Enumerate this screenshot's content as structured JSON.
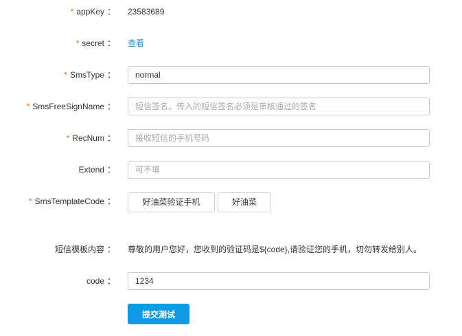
{
  "form": {
    "appkey": {
      "label": "appKey",
      "value": "23583689",
      "required": true
    },
    "secret": {
      "label": "secret",
      "link_text": "查看",
      "required": true
    },
    "smstype": {
      "label": "SmsType",
      "value": "normal",
      "placeholder": "",
      "required": true
    },
    "signname": {
      "label": "SmsFreeSignName",
      "value": "",
      "placeholder": "短信签名，传入的短信签名必须是审核通过的签名",
      "required": true
    },
    "recnum": {
      "label": "RecNum",
      "value": "",
      "placeholder": "接收短信的手机号码",
      "required": true
    },
    "extend": {
      "label": "Extend",
      "value": "",
      "placeholder": "可不填",
      "required": false
    },
    "template": {
      "label": "SmsTemplateCode",
      "required": true,
      "options": [
        "好油菜验证手机",
        "好油菜"
      ]
    },
    "content": {
      "label": "短信模板内容",
      "value": "尊敬的用户您好，您收到的验证码是${code},请验证您的手机，切勿转发给别人。"
    },
    "code": {
      "label": "code",
      "value": "1234",
      "placeholder": ""
    },
    "submit_label": "提交测试",
    "required_mark": "*",
    "colon": "："
  },
  "colors": {
    "required_mark": "#ff6600",
    "link": "#1a8fd8",
    "submit_bg": "#0e9ae7"
  }
}
